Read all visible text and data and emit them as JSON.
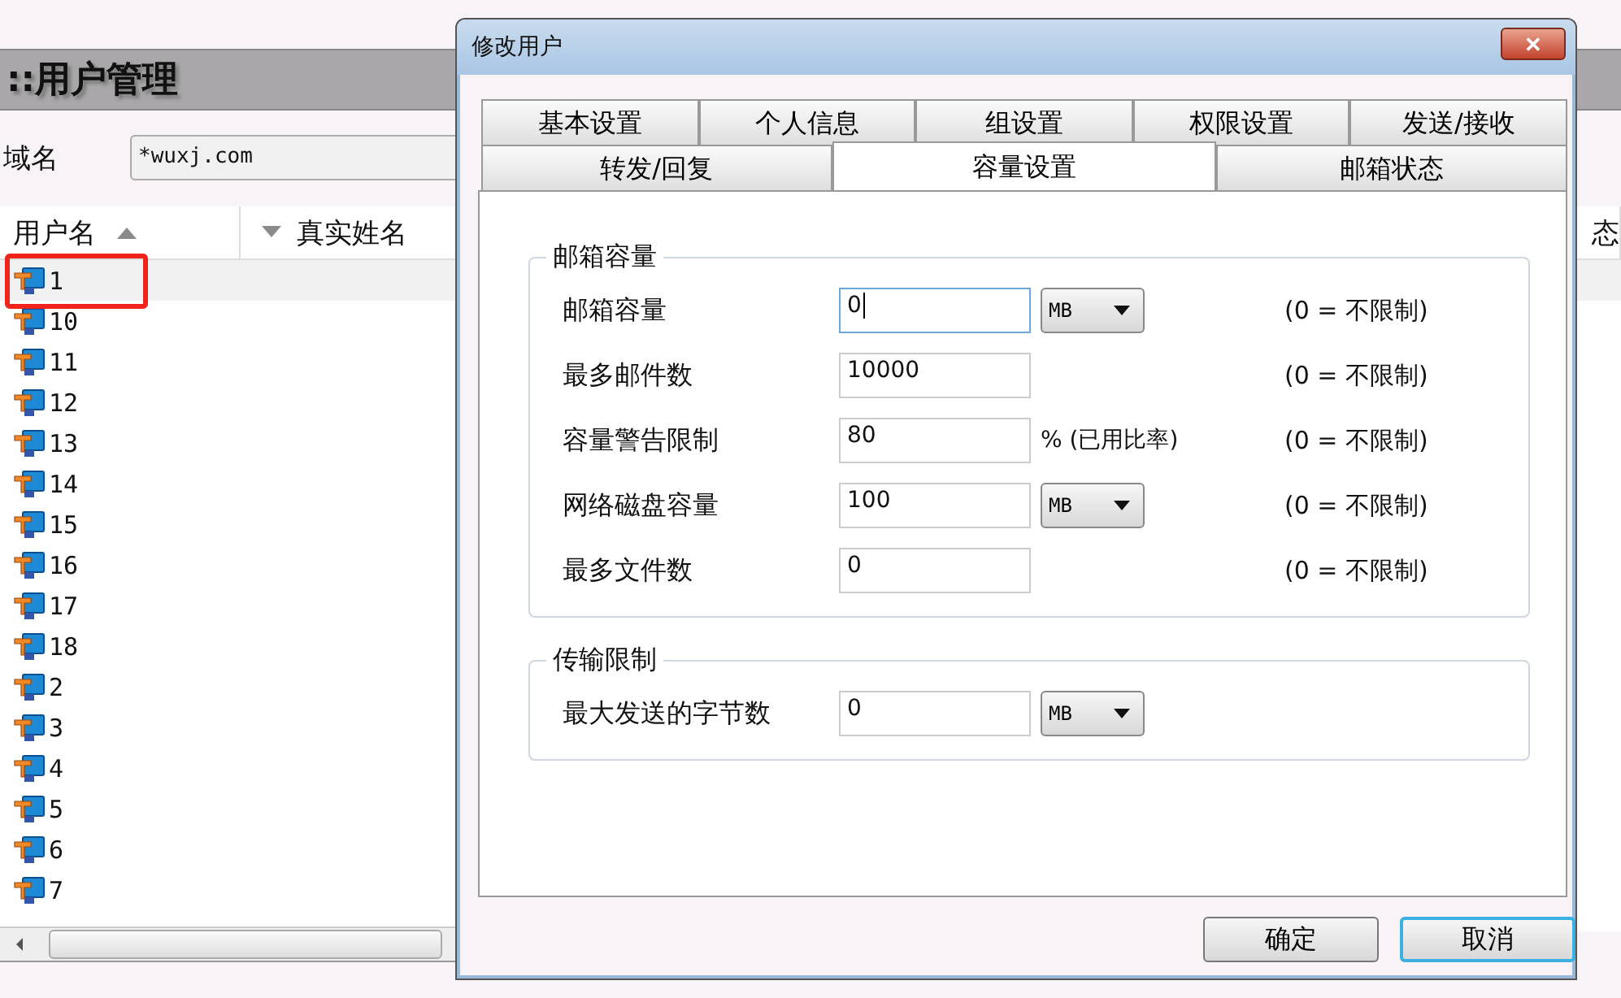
{
  "page": {
    "title": "::用户管理",
    "domain_label": "域名",
    "domain_value": "*wuxj.com",
    "columns": [
      {
        "label": "用户名",
        "kind": "sorted-asc"
      },
      {
        "label": "真实姓名",
        "kind": "sorted-desc"
      },
      {
        "label": "态",
        "kind": "plain"
      }
    ],
    "rows": [
      {
        "name": "1",
        "selected": true
      },
      {
        "name": "10",
        "selected": false
      },
      {
        "name": "11",
        "selected": false
      },
      {
        "name": "12",
        "selected": false
      },
      {
        "name": "13",
        "selected": false
      },
      {
        "name": "14",
        "selected": false
      },
      {
        "name": "15",
        "selected": false
      },
      {
        "name": "16",
        "selected": false
      },
      {
        "name": "17",
        "selected": false
      },
      {
        "name": "18",
        "selected": false
      },
      {
        "name": "2",
        "selected": false
      },
      {
        "name": "3",
        "selected": false
      },
      {
        "name": "4",
        "selected": false
      },
      {
        "name": "5",
        "selected": false
      },
      {
        "name": "6",
        "selected": false
      },
      {
        "name": "7",
        "selected": false
      }
    ]
  },
  "dialog": {
    "title": "修改用户",
    "close": "✕",
    "tab_rows": [
      [
        {
          "label": "基本设置",
          "selected": false
        },
        {
          "label": "个人信息",
          "selected": false
        },
        {
          "label": "组设置",
          "selected": false
        },
        {
          "label": "权限设置",
          "selected": false
        },
        {
          "label": "发送/接收",
          "selected": false
        }
      ],
      [
        {
          "label": "转发/回复",
          "selected": false
        },
        {
          "label": "容量设置",
          "selected": true
        },
        {
          "label": "邮箱状态",
          "selected": false
        }
      ]
    ],
    "groups": [
      {
        "title": "邮箱容量",
        "fields": [
          {
            "kind": "select",
            "label": "邮箱容量",
            "value": "0",
            "focused": true,
            "unit": "MB",
            "hint": "(0 = 不限制)"
          },
          {
            "kind": "plain",
            "label": "最多邮件数",
            "value": "10000",
            "focused": false,
            "hint": "(0 = 不限制)"
          },
          {
            "kind": "suffix",
            "label": "容量警告限制",
            "value": "80",
            "focused": false,
            "suffix": "% (已用比率)",
            "hint": "(0 = 不限制)"
          },
          {
            "kind": "select",
            "label": "网络磁盘容量",
            "value": "100",
            "focused": false,
            "unit": "MB",
            "hint": "(0 = 不限制)"
          },
          {
            "kind": "plain",
            "label": "最多文件数",
            "value": "0",
            "focused": false,
            "hint": "(0 = 不限制)"
          }
        ]
      },
      {
        "title": "传输限制",
        "fields": [
          {
            "kind": "select",
            "label": "最大发送的字节数",
            "value": "0",
            "focused": false,
            "unit": "MB"
          }
        ]
      }
    ],
    "buttons": [
      {
        "label": "确定",
        "default": false
      },
      {
        "label": "取消",
        "default": true
      }
    ]
  }
}
